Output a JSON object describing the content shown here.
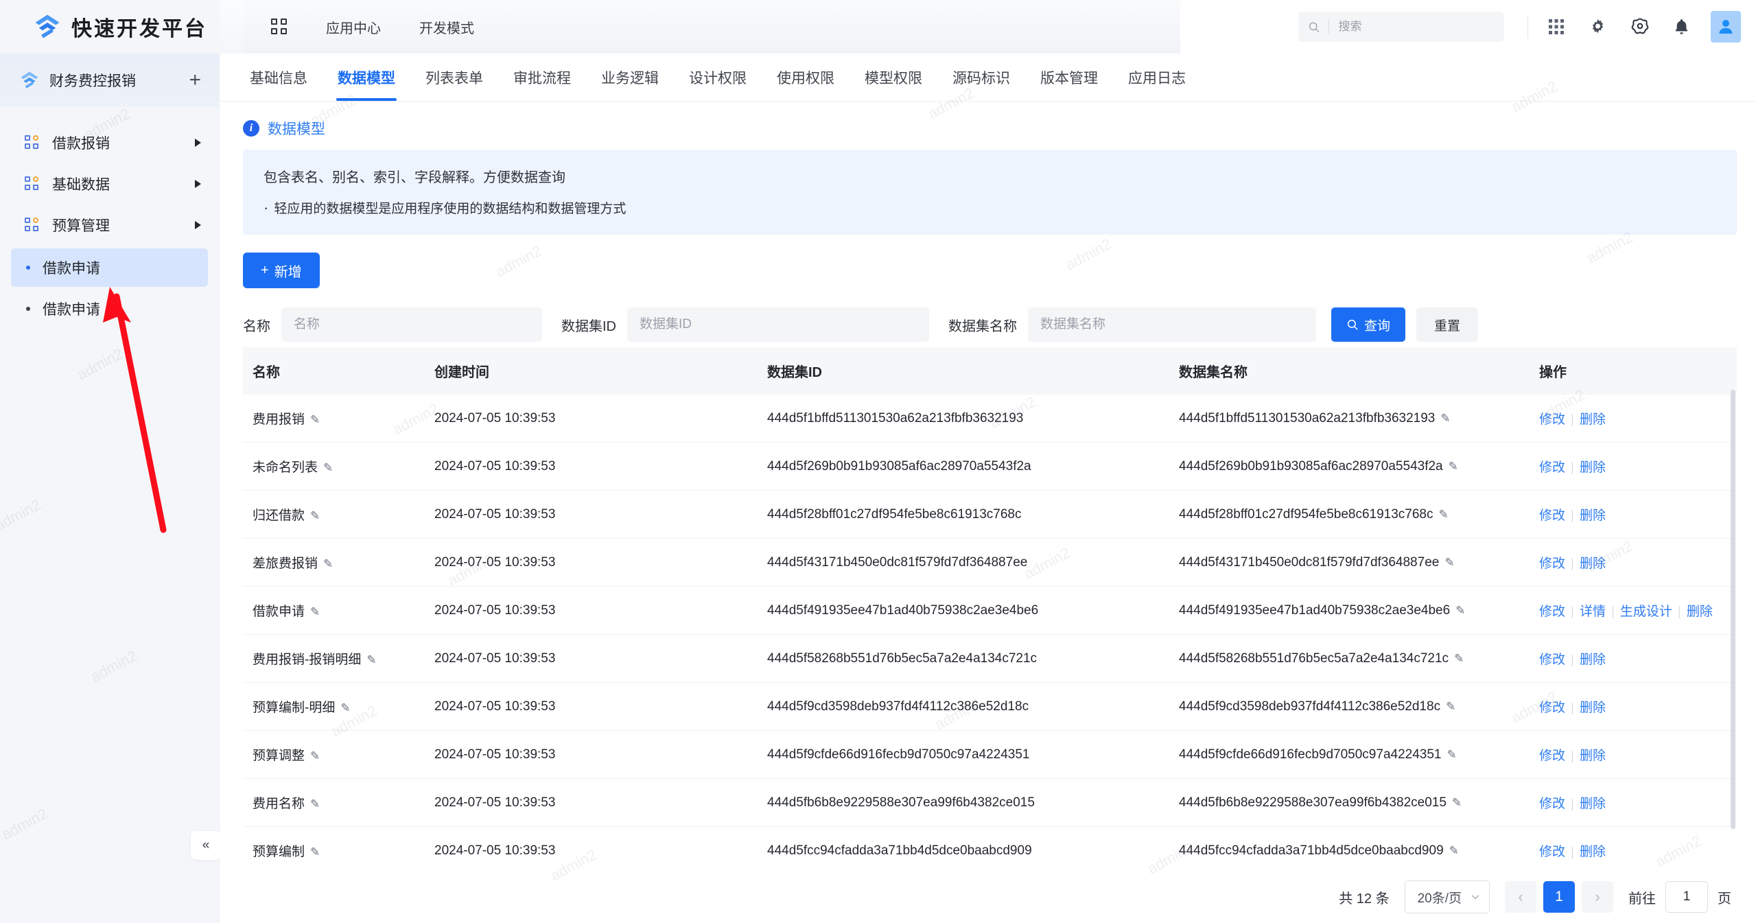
{
  "brand": {
    "name": "快速开发平台",
    "logo_icon": "platform-logo-icon"
  },
  "topnav": {
    "apps_grid_icon": "apps-grid-icon",
    "links": [
      {
        "label": "应用中心"
      },
      {
        "label": "开发模式"
      }
    ]
  },
  "topbar_right": {
    "search_placeholder": "搜索",
    "search_value": "",
    "search_icon": "search-icon",
    "icons": [
      {
        "name": "apps-grid-icon"
      },
      {
        "name": "gear-icon"
      },
      {
        "name": "settings-flower-icon"
      },
      {
        "name": "bell-icon"
      }
    ],
    "avatar_icon": "user-avatar-icon"
  },
  "sidebar": {
    "app_title": "财务费控报销",
    "add_icon": "plus-icon",
    "menu": [
      {
        "label": "借款报销",
        "expandable": true
      },
      {
        "label": "基础数据",
        "expandable": true
      },
      {
        "label": "预算管理",
        "expandable": true
      }
    ],
    "sub_items": [
      {
        "label": "借款申请",
        "active": true
      },
      {
        "label": "借款申请",
        "active": false
      }
    ],
    "collapse_icon": "«"
  },
  "tabs": [
    {
      "label": "基础信息",
      "active": false
    },
    {
      "label": "数据模型",
      "active": true
    },
    {
      "label": "列表表单",
      "active": false
    },
    {
      "label": "审批流程",
      "active": false
    },
    {
      "label": "业务逻辑",
      "active": false
    },
    {
      "label": "设计权限",
      "active": false
    },
    {
      "label": "使用权限",
      "active": false
    },
    {
      "label": "模型权限",
      "active": false
    },
    {
      "label": "源码标识",
      "active": false
    },
    {
      "label": "版本管理",
      "active": false
    },
    {
      "label": "应用日志",
      "active": false
    }
  ],
  "info": {
    "icon": "info-icon",
    "title": "数据模型",
    "line1": "包含表名、别名、索引、字段解释。方便数据查询",
    "line2": "轻应用的数据模型是应用程序使用的数据结构和数据管理方式"
  },
  "toolbar": {
    "add_label": "新增",
    "add_icon": "plus-icon"
  },
  "filters": {
    "name": {
      "label": "名称",
      "placeholder": "名称",
      "value": ""
    },
    "dataset_id": {
      "label": "数据集ID",
      "placeholder": "数据集ID",
      "value": ""
    },
    "dataset_name": {
      "label": "数据集名称",
      "placeholder": "数据集名称",
      "value": ""
    },
    "search_label": "查询",
    "search_icon": "search-icon",
    "reset_label": "重置"
  },
  "table": {
    "columns": [
      "名称",
      "创建时间",
      "数据集ID",
      "数据集名称",
      "操作"
    ],
    "edit_icon": "pencil-icon",
    "rows": [
      {
        "name": "费用报销",
        "created": "2024-07-05 10:39:53",
        "dataset_id": "444d5f1bffd511301530a62a213fbfb3632193",
        "dataset_name": "444d5f1bffd511301530a62a213fbfb3632193",
        "ops": [
          "修改",
          "删除"
        ]
      },
      {
        "name": "未命名列表",
        "created": "2024-07-05 10:39:53",
        "dataset_id": "444d5f269b0b91b93085af6ac28970a5543f2a",
        "dataset_name": "444d5f269b0b91b93085af6ac28970a5543f2a",
        "ops": [
          "修改",
          "删除"
        ]
      },
      {
        "name": "归还借款",
        "created": "2024-07-05 10:39:53",
        "dataset_id": "444d5f28bff01c27df954fe5be8c61913c768c",
        "dataset_name": "444d5f28bff01c27df954fe5be8c61913c768c",
        "ops": [
          "修改",
          "删除"
        ]
      },
      {
        "name": "差旅费报销",
        "created": "2024-07-05 10:39:53",
        "dataset_id": "444d5f43171b450e0dc81f579fd7df364887ee",
        "dataset_name": "444d5f43171b450e0dc81f579fd7df364887ee",
        "ops": [
          "修改",
          "删除"
        ]
      },
      {
        "name": "借款申请",
        "created": "2024-07-05 10:39:53",
        "dataset_id": "444d5f491935ee47b1ad40b75938c2ae3e4be6",
        "dataset_name": "444d5f491935ee47b1ad40b75938c2ae3e4be6",
        "ops": [
          "修改",
          "详情",
          "生成设计",
          "删除"
        ]
      },
      {
        "name": "费用报销-报销明细",
        "created": "2024-07-05 10:39:53",
        "dataset_id": "444d5f58268b551d76b5ec5a7a2e4a134c721c",
        "dataset_name": "444d5f58268b551d76b5ec5a7a2e4a134c721c",
        "ops": [
          "修改",
          "删除"
        ]
      },
      {
        "name": "预算编制-明细",
        "created": "2024-07-05 10:39:53",
        "dataset_id": "444d5f9cd3598deb937fd4f4112c386e52d18c",
        "dataset_name": "444d5f9cd3598deb937fd4f4112c386e52d18c",
        "ops": [
          "修改",
          "删除"
        ]
      },
      {
        "name": "预算调整",
        "created": "2024-07-05 10:39:53",
        "dataset_id": "444d5f9cfde66d916fecb9d7050c97a4224351",
        "dataset_name": "444d5f9cfde66d916fecb9d7050c97a4224351",
        "ops": [
          "修改",
          "删除"
        ]
      },
      {
        "name": "费用名称",
        "created": "2024-07-05 10:39:53",
        "dataset_id": "444d5fb6b8e9229588e307ea99f6b4382ce015",
        "dataset_name": "444d5fb6b8e9229588e307ea99f6b4382ce015",
        "ops": [
          "修改",
          "删除"
        ]
      },
      {
        "name": "预算编制",
        "created": "2024-07-05 10:39:53",
        "dataset_id": "444d5fcc94cfadda3a71bb4d5dce0baabcd909",
        "dataset_name": "444d5fcc94cfadda3a71bb4d5dce0baabcd909",
        "ops": [
          "修改",
          "删除"
        ]
      }
    ]
  },
  "pagination": {
    "total_text": "共 12 条",
    "page_size": "20条/页",
    "prev_icon": "chevron-left-icon",
    "next_icon": "chevron-right-icon",
    "current_page": "1",
    "goto_label": "前往",
    "goto_value": "1",
    "page_unit": "页"
  },
  "watermark": {
    "text": "admin2"
  },
  "annotation": {
    "arrow_color": "#fc0d1b"
  },
  "colors": {
    "accent": "#1b6ef3",
    "link": "#2f7df0",
    "sidebar_bg": "#f4f6f9",
    "active_item_bg": "#d6e4fd",
    "info_bg": "#eef4fe"
  }
}
